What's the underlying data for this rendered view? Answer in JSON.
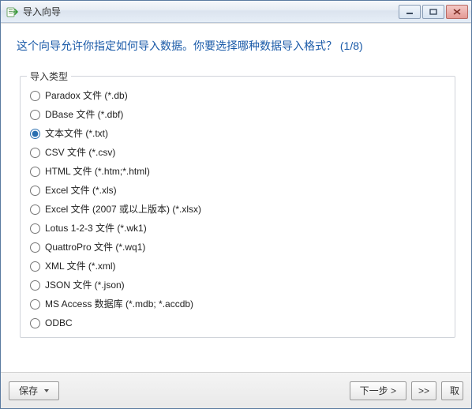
{
  "window": {
    "title": "导入向导"
  },
  "heading": "这个向导允许你指定如何导入数据。你要选择哪种数据导入格式？ (1/8)",
  "group": {
    "legend": "导入类型",
    "selected_index": 2,
    "options": [
      {
        "label": "Paradox 文件 (*.db)"
      },
      {
        "label": "DBase 文件 (*.dbf)"
      },
      {
        "label": "文本文件 (*.txt)"
      },
      {
        "label": "CSV 文件 (*.csv)"
      },
      {
        "label": "HTML 文件 (*.htm;*.html)"
      },
      {
        "label": "Excel 文件 (*.xls)"
      },
      {
        "label": "Excel 文件 (2007 或以上版本) (*.xlsx)"
      },
      {
        "label": "Lotus 1-2-3 文件 (*.wk1)"
      },
      {
        "label": "QuattroPro 文件 (*.wq1)"
      },
      {
        "label": "XML 文件 (*.xml)"
      },
      {
        "label": "JSON 文件 (*.json)"
      },
      {
        "label": "MS Access 数据库 (*.mdb; *.accdb)"
      },
      {
        "label": "ODBC"
      }
    ]
  },
  "footer": {
    "save_label": "保存",
    "next_label": "下一步 >",
    "skip_label": ">>",
    "cancel_label": "取"
  }
}
